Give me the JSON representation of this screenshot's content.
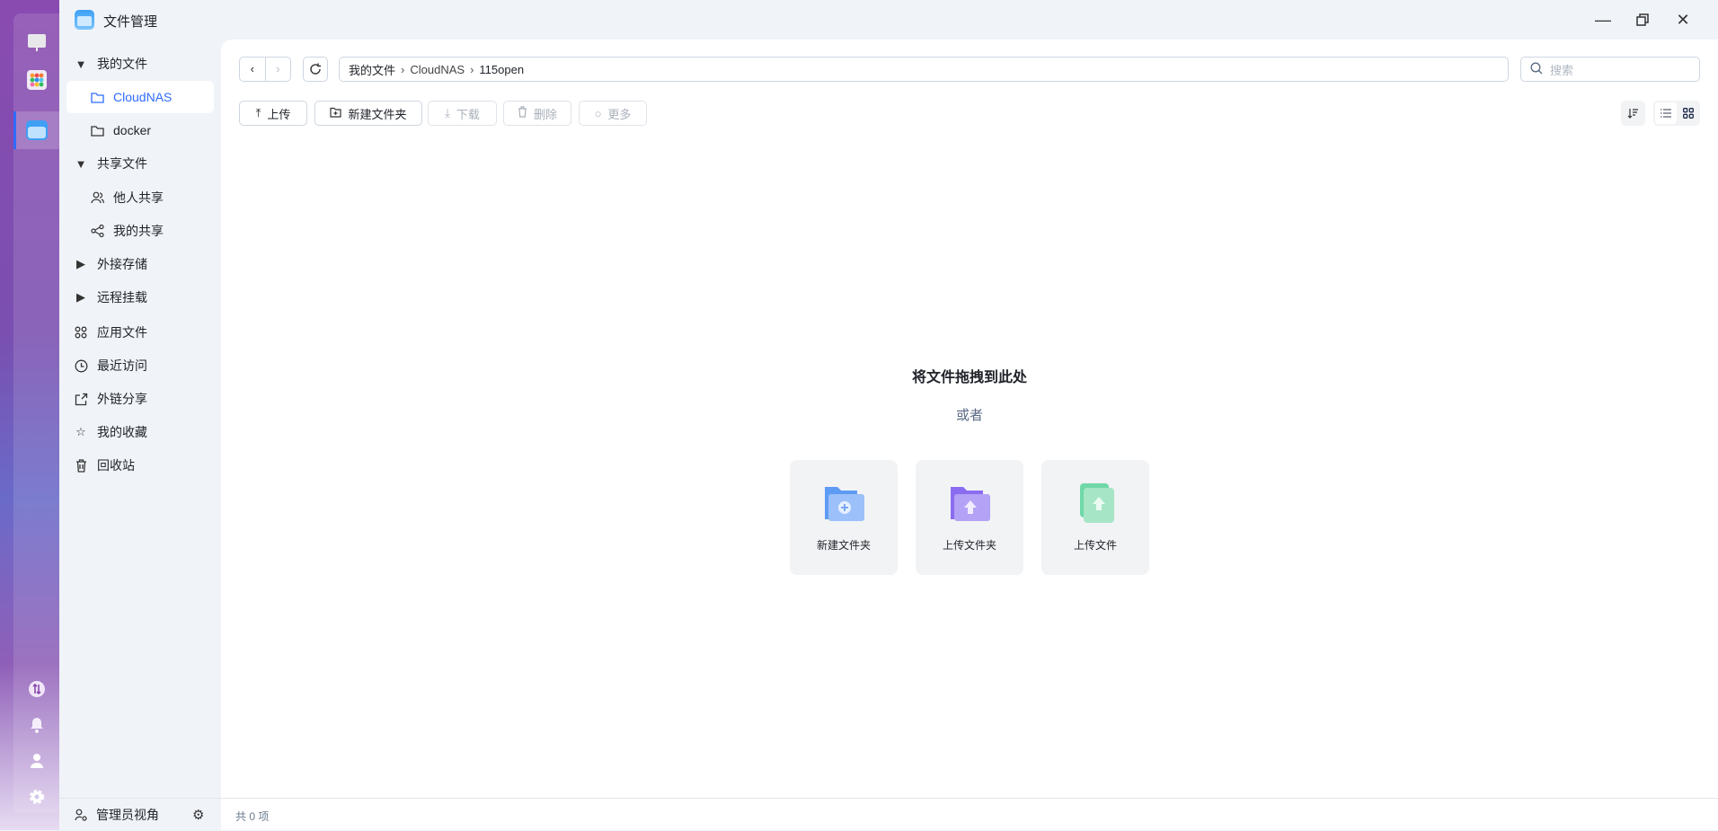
{
  "window": {
    "title": "文件管理"
  },
  "sidebar": {
    "items": [
      {
        "label": "我的文件",
        "icon": "caret-down-icon"
      },
      {
        "label": "CloudNAS",
        "icon": "folder-icon",
        "selected": true
      },
      {
        "label": "docker",
        "icon": "folder-icon"
      },
      {
        "label": "共享文件",
        "icon": "caret-down-icon"
      },
      {
        "label": "他人共享",
        "icon": "users-icon"
      },
      {
        "label": "我的共享",
        "icon": "share-icon"
      },
      {
        "label": "外接存储",
        "icon": "caret-right-icon"
      },
      {
        "label": "远程挂载",
        "icon": "caret-right-icon"
      },
      {
        "label": "应用文件",
        "icon": "apps-icon"
      },
      {
        "label": "最近访问",
        "icon": "clock-icon"
      },
      {
        "label": "外链分享",
        "icon": "external-share-icon"
      },
      {
        "label": "我的收藏",
        "icon": "star-icon"
      },
      {
        "label": "回收站",
        "icon": "trash-icon"
      }
    ],
    "footer": {
      "admin_view": "管理员视角"
    }
  },
  "breadcrumb": [
    "我的文件",
    "CloudNAS",
    "115open"
  ],
  "search": {
    "placeholder": "搜索"
  },
  "toolbar": {
    "upload": "上传",
    "new_folder": "新建文件夹",
    "download": "下载",
    "delete": "删除",
    "more": "更多"
  },
  "empty": {
    "drop_text": "将文件拖拽到此处",
    "or": "或者",
    "cards": [
      "新建文件夹",
      "上传文件夹",
      "上传文件"
    ]
  },
  "status": {
    "count": "共 0 项"
  },
  "colors": {
    "accent": "#2f6bff",
    "sidebar_bg": "#f0f3f8"
  }
}
